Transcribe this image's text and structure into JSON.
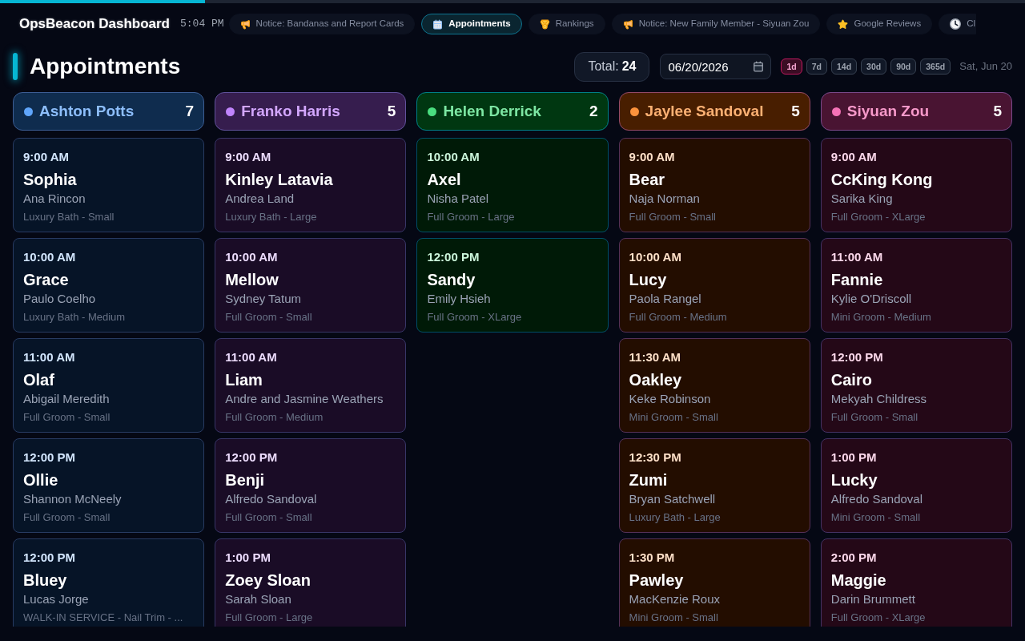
{
  "progress": {
    "level": 0.2
  },
  "topbar": {
    "title": "OpsBeacon Dashboard",
    "time": "5:04 PM",
    "tabs": [
      {
        "label": "Notice: Bandanas and Report Cards",
        "kind": "notice",
        "selected": false
      },
      {
        "label": "Appointments",
        "kind": "calendar",
        "selected": true
      },
      {
        "label": "Rankings",
        "kind": "rankings",
        "selected": false
      },
      {
        "label": "Notice: New Family Member - Siyuan Zou",
        "kind": "notice",
        "selected": false
      },
      {
        "label": "Google Reviews",
        "kind": "reviews",
        "selected": false
      },
      {
        "label": "Cl",
        "kind": "clock",
        "selected": false
      }
    ]
  },
  "header": {
    "title": "Appointments",
    "total": {
      "label": "Total:",
      "value": "24"
    },
    "date_field": {
      "value": "06/20/2026"
    },
    "ranges": [
      {
        "label": "1d",
        "selected": true
      },
      {
        "label": "7d",
        "selected": false
      },
      {
        "label": "14d",
        "selected": false
      },
      {
        "label": "30d",
        "selected": false
      },
      {
        "label": "90d",
        "selected": false
      },
      {
        "label": "365d",
        "selected": false
      }
    ],
    "date_label": "Sat, Jun 20"
  },
  "columns": [
    {
      "name": "Ashton Potts",
      "count": "7",
      "color": "#60a5fa",
      "appointments": [
        {
          "time": "9:00 AM",
          "pet": "Sophia",
          "owner": "Ana Rincon",
          "service": "Luxury Bath - Small"
        },
        {
          "time": "10:00 AM",
          "pet": "Grace",
          "owner": "Paulo Coelho",
          "service": "Luxury Bath - Medium"
        },
        {
          "time": "11:00 AM",
          "pet": "Olaf",
          "owner": "Abigail Meredith",
          "service": "Full Groom - Small"
        },
        {
          "time": "12:00 PM",
          "pet": "Ollie",
          "owner": "Shannon McNeely",
          "service": "Full Groom - Small"
        },
        {
          "time": "12:00 PM",
          "pet": "Bluey",
          "owner": "Lucas Jorge",
          "service": "WALK-IN SERVICE - Nail Trim - ..."
        }
      ]
    },
    {
      "name": "Franko Harris",
      "count": "5",
      "color": "#c084fc",
      "appointments": [
        {
          "time": "9:00 AM",
          "pet": "Kinley Latavia",
          "owner": "Andrea Land",
          "service": "Luxury Bath - Large"
        },
        {
          "time": "10:00 AM",
          "pet": "Mellow",
          "owner": "Sydney Tatum",
          "service": "Full Groom - Small"
        },
        {
          "time": "11:00 AM",
          "pet": "Liam",
          "owner": "Andre and Jasmine Weathers",
          "service": "Full Groom - Medium"
        },
        {
          "time": "12:00 PM",
          "pet": "Benji",
          "owner": "Alfredo Sandoval",
          "service": "Full Groom - Small"
        },
        {
          "time": "1:00 PM",
          "pet": "Zoey Sloan",
          "owner": "Sarah Sloan",
          "service": "Full Groom - Large"
        }
      ]
    },
    {
      "name": "Helen Derrick",
      "count": "2",
      "color": "#4ade80",
      "appointments": [
        {
          "time": "10:00 AM",
          "pet": "Axel",
          "owner": "Nisha Patel",
          "service": "Full Groom - Large"
        },
        {
          "time": "12:00 PM",
          "pet": "Sandy",
          "owner": "Emily Hsieh",
          "service": "Full Groom - XLarge"
        }
      ]
    },
    {
      "name": "Jaylee Sandoval",
      "count": "5",
      "color": "#fb923c",
      "appointments": [
        {
          "time": "9:00 AM",
          "pet": "Bear",
          "owner": "Naja Norman",
          "service": "Full Groom - Small"
        },
        {
          "time": "10:00 AM",
          "pet": "Lucy",
          "owner": "Paola Rangel",
          "service": "Full Groom - Medium"
        },
        {
          "time": "11:30 AM",
          "pet": "Oakley",
          "owner": "Keke Robinson",
          "service": "Mini Groom - Small"
        },
        {
          "time": "12:30 PM",
          "pet": "Zumi",
          "owner": "Bryan Satchwell",
          "service": "Luxury Bath - Large"
        },
        {
          "time": "1:30 PM",
          "pet": "Pawley",
          "owner": "MacKenzie Roux",
          "service": "Mini Groom - Small"
        }
      ]
    },
    {
      "name": "Siyuan Zou",
      "count": "5",
      "color": "#f472b6",
      "appointments": [
        {
          "time": "9:00 AM",
          "pet": "CcKing Kong",
          "owner": "Sarika King",
          "service": "Full Groom - XLarge"
        },
        {
          "time": "11:00 AM",
          "pet": "Fannie",
          "owner": "Kylie O'Driscoll",
          "service": "Mini Groom - Medium"
        },
        {
          "time": "12:00 PM",
          "pet": "Cairo",
          "owner": "Mekyah Childress",
          "service": "Full Groom - Small"
        },
        {
          "time": "1:00 PM",
          "pet": "Lucky",
          "owner": "Alfredo Sandoval",
          "service": "Mini Groom - Small"
        },
        {
          "time": "2:00 PM",
          "pet": "Maggie",
          "owner": "Darin Brummett",
          "service": "Full Groom - XLarge"
        }
      ]
    }
  ]
}
